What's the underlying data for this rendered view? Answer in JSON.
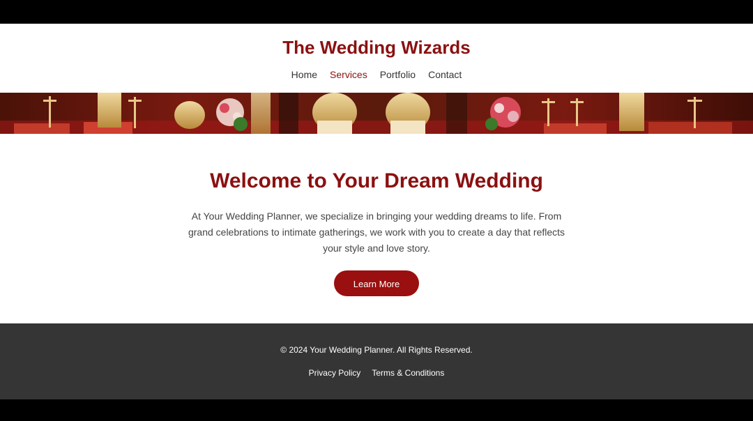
{
  "site": {
    "title": "The Wedding Wizards"
  },
  "nav": {
    "items": [
      {
        "label": "Home"
      },
      {
        "label": "Services"
      },
      {
        "label": "Portfolio"
      },
      {
        "label": "Contact"
      }
    ]
  },
  "hero": {
    "title": "Welcome to Your Dream Wedding",
    "text": "At Your Wedding Planner, we specialize in bringing your wedding dreams to life. From grand celebrations to intimate gatherings, we work with you to create a day that reflects your style and love story.",
    "button_label": "Learn More"
  },
  "footer": {
    "copyright": "© 2024 Your Wedding Planner. All Rights Reserved.",
    "links": [
      {
        "label": "Privacy Policy"
      },
      {
        "label": "Terms & Conditions"
      }
    ]
  },
  "colors": {
    "brand": "#8b1010",
    "button": "#9a0f0f",
    "footer_bg": "#353535",
    "frame_bg": "#000000"
  }
}
